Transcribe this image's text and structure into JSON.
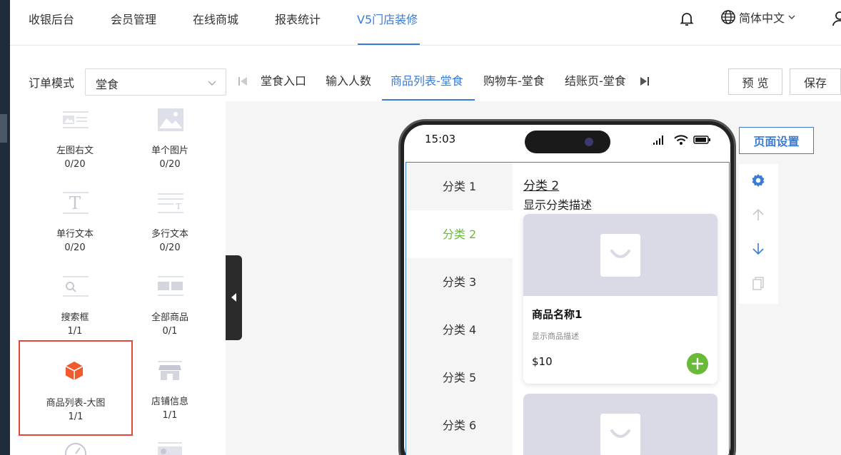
{
  "topnav": {
    "items": [
      "收银后台",
      "会员管理",
      "在线商城",
      "报表统计",
      "V5门店装修"
    ],
    "active_index": 4,
    "language": "简体中文"
  },
  "toolbar": {
    "order_mode_label": "订单模式",
    "order_mode_value": "堂食",
    "steps": [
      "堂食入口",
      "输入人数",
      "商品列表-堂食",
      "购物车-堂食",
      "结账页-堂食"
    ],
    "active_step": 2,
    "preview_label": "预 览",
    "save_label": "保存"
  },
  "components": [
    {
      "name": "左图右文",
      "count": "0/20",
      "icon": "image-text-icon"
    },
    {
      "name": "单个图片",
      "count": "0/20",
      "icon": "image-icon"
    },
    {
      "name": "单行文本",
      "count": "0/20",
      "icon": "text-icon"
    },
    {
      "name": "多行文本",
      "count": "0/20",
      "icon": "multiline-text-icon"
    },
    {
      "name": "搜索框",
      "count": "1/1",
      "icon": "search-box-icon"
    },
    {
      "name": "全部商品",
      "count": "0/1",
      "icon": "all-products-icon"
    },
    {
      "name": "商品列表-大图",
      "count": "1/1",
      "icon": "cube-icon",
      "selected": true
    },
    {
      "name": "店铺信息",
      "count": "1/1",
      "icon": "shop-icon"
    }
  ],
  "phone": {
    "time": "15:03",
    "categories": [
      "分类 1",
      "分类 2",
      "分类 3",
      "分类 4",
      "分类 5",
      "分类 6"
    ],
    "active_category": 1,
    "category_title": "分类 2",
    "category_desc": "显示分类描述",
    "product": {
      "name": "商品名称1",
      "desc": "显示商品描述",
      "price": "$10"
    }
  },
  "right_panel": {
    "page_settings_label": "页面设置",
    "tools": [
      "gear-icon",
      "arrow-up-icon",
      "arrow-down-icon",
      "copy-icon"
    ]
  },
  "colors": {
    "accent": "#3a7bd5",
    "green": "#6aba3a",
    "selected_border": "#e0483e",
    "cube": "#f25a2c"
  }
}
